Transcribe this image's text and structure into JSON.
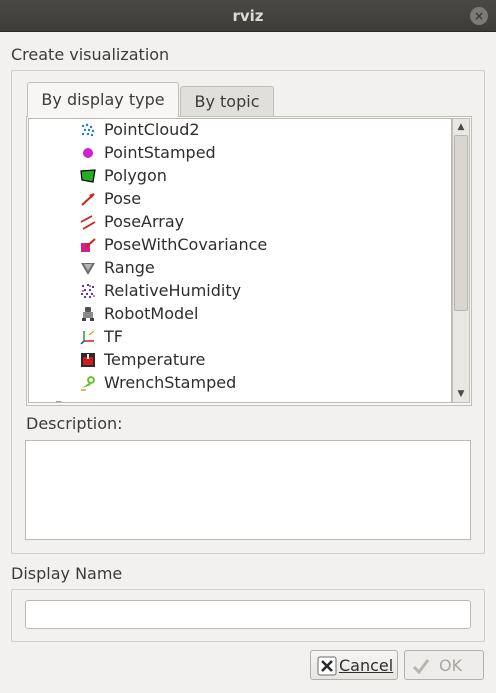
{
  "window": {
    "title": "rviz",
    "close_glyph": "×"
  },
  "dialog": {
    "create_label": "Create visualization",
    "tabs": [
      {
        "label": "By display type",
        "active": true
      },
      {
        "label": "By topic",
        "active": false
      }
    ],
    "display_types": [
      {
        "label": "PointCloud2",
        "icon": "pointcloud2-icon"
      },
      {
        "label": "PointStamped",
        "icon": "pointstamped-icon"
      },
      {
        "label": "Polygon",
        "icon": "polygon-icon"
      },
      {
        "label": "Pose",
        "icon": "pose-icon"
      },
      {
        "label": "PoseArray",
        "icon": "posearray-icon"
      },
      {
        "label": "PoseWithCovariance",
        "icon": "posewithcovariance-icon"
      },
      {
        "label": "Range",
        "icon": "range-icon"
      },
      {
        "label": "RelativeHumidity",
        "icon": "relativehumidity-icon"
      },
      {
        "label": "RobotModel",
        "icon": "robotmodel-icon"
      },
      {
        "label": "TF",
        "icon": "tf-icon"
      },
      {
        "label": "Temperature",
        "icon": "temperature-icon"
      },
      {
        "label": "WrenchStamped",
        "icon": "wrenchstamped-icon"
      }
    ],
    "description_label": "Description:",
    "description_text": "",
    "display_name_label": "Display Name",
    "display_name_value": "",
    "cancel_label": "Cancel",
    "ok_label": "OK"
  },
  "colors": {
    "titlebar": "#3d3c38",
    "background": "#f2f1f0",
    "list_background": "#ffffff"
  }
}
